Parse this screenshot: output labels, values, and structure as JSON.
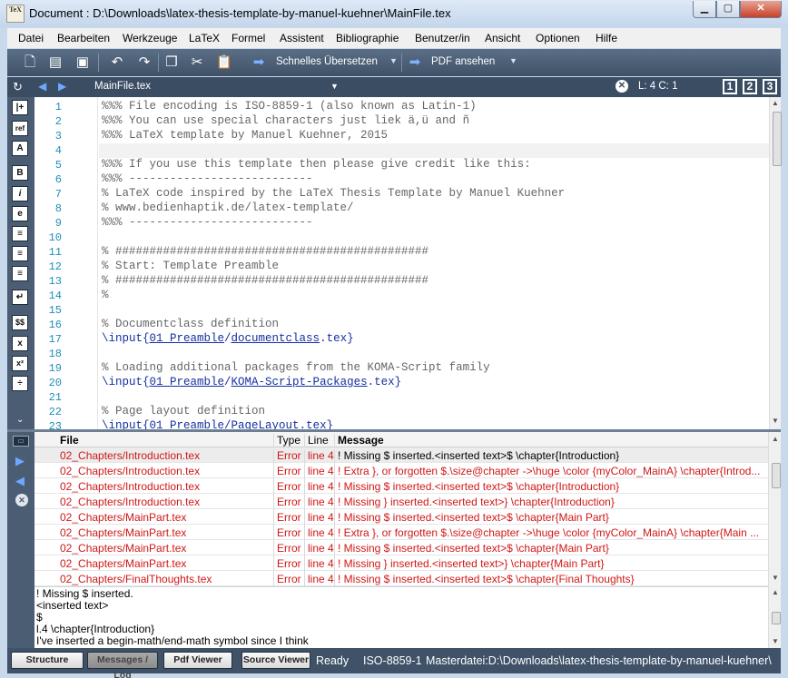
{
  "window": {
    "title": "Document : D:\\Downloads\\latex-thesis-template-by-manuel-kuehner\\MainFile.tex",
    "app_icon_text": "TeX",
    "minimize": "▁",
    "maximize": "▢",
    "close": "✕"
  },
  "menu": [
    "Datei",
    "Bearbeiten",
    "Werkzeuge",
    "LaTeX",
    "Formel",
    "Assistent",
    "Bibliographie",
    "Benutzer/in",
    "Ansicht",
    "Optionen",
    "Hilfe"
  ],
  "toolbar": {
    "build_label": "Schnelles Übersetzen",
    "view_label": "PDF ansehen",
    "icons": [
      "new-file-icon",
      "open-file-icon",
      "save-icon",
      "undo-icon",
      "redo-icon",
      "copy-icon",
      "cut-icon",
      "paste-icon",
      "run-arrow-icon",
      "view-arrow-icon"
    ]
  },
  "tabbar": {
    "file_name": "MainFile.tex",
    "cursor_pos": "L: 4 C: 1",
    "view1": "1",
    "view2": "2",
    "view3": "3"
  },
  "left_panel_icons": [
    "|+",
    "ref",
    "A",
    "B",
    "i",
    "e",
    "≡",
    "≡",
    "≡",
    "↵",
    "$$",
    "x",
    "x²",
    "÷"
  ],
  "editor": {
    "lines": [
      {
        "num": "1",
        "text": "%%% File encoding is ISO-8859-1 (also known as Latin-1)"
      },
      {
        "num": "2",
        "text": "%%% You can use special characters just liek ä,ü and ñ"
      },
      {
        "num": "3",
        "text": "%%% LaTeX template by Manuel Kuehner, 2015"
      },
      {
        "num": "4",
        "text": ""
      },
      {
        "num": "5",
        "text": "%%% If you use this template then please give credit like this:"
      },
      {
        "num": "6",
        "text": "%%% ---------------------------"
      },
      {
        "num": "7",
        "text": "% LaTeX code inspired by the LaTeX Thesis Template by Manuel Kuehner"
      },
      {
        "num": "8",
        "text": "% www.bedienhaptik.de/latex-template/"
      },
      {
        "num": "9",
        "text": "%%% ---------------------------"
      },
      {
        "num": "10",
        "text": ""
      },
      {
        "num": "11",
        "text": "% ##############################################"
      },
      {
        "num": "12",
        "text": "% Start: Template Preamble"
      },
      {
        "num": "13",
        "text": "% ##############################################"
      },
      {
        "num": "14",
        "text": "%"
      },
      {
        "num": "15",
        "text": ""
      },
      {
        "num": "16",
        "text": "% Documentclass definition"
      },
      {
        "num": "17",
        "text": "\\input{01_Preamble/documentclass.tex}"
      },
      {
        "num": "18",
        "text": ""
      },
      {
        "num": "19",
        "text": "% Loading additional packages from the KOMA-Script family"
      },
      {
        "num": "20",
        "text": "\\input{01_Preamble/KOMA-Script-Packages.tex}"
      },
      {
        "num": "21",
        "text": ""
      },
      {
        "num": "22",
        "text": "% Page layout definition"
      },
      {
        "num": "23",
        "text": "\\input{01_Preamble/PageLayout.tex}"
      }
    ]
  },
  "messages": {
    "headers": {
      "file": "File",
      "type": "Type",
      "line": "Line",
      "message": "Message"
    },
    "rows": [
      {
        "file": "02_Chapters/Introduction.tex",
        "type": "Error",
        "line": "line 4",
        "message": "! Missing $ inserted.<inserted text>$ \\chapter{Introduction}"
      },
      {
        "file": "02_Chapters/Introduction.tex",
        "type": "Error",
        "line": "line 4",
        "message": "! Extra }, or forgotten $.\\size@chapter ->\\huge \\color {myColor_MainA} \\chapter{Introd..."
      },
      {
        "file": "02_Chapters/Introduction.tex",
        "type": "Error",
        "line": "line 4",
        "message": "! Missing $ inserted.<inserted text>$ \\chapter{Introduction}"
      },
      {
        "file": "02_Chapters/Introduction.tex",
        "type": "Error",
        "line": "line 4",
        "message": "! Missing } inserted.<inserted text>} \\chapter{Introduction}"
      },
      {
        "file": "02_Chapters/MainPart.tex",
        "type": "Error",
        "line": "line 4",
        "message": "! Missing $ inserted.<inserted text>$ \\chapter{Main Part}"
      },
      {
        "file": "02_Chapters/MainPart.tex",
        "type": "Error",
        "line": "line 4",
        "message": "! Extra }, or forgotten $.\\size@chapter ->\\huge \\color {myColor_MainA} \\chapter{Main ..."
      },
      {
        "file": "02_Chapters/MainPart.tex",
        "type": "Error",
        "line": "line 4",
        "message": "! Missing $ inserted.<inserted text>$ \\chapter{Main Part}"
      },
      {
        "file": "02_Chapters/MainPart.tex",
        "type": "Error",
        "line": "line 4",
        "message": "! Missing } inserted.<inserted text>} \\chapter{Main Part}"
      },
      {
        "file": "02_Chapters/FinalThoughts.tex",
        "type": "Error",
        "line": "line 4",
        "message": "! Missing $ inserted.<inserted text>$ \\chapter{Final Thoughts}"
      }
    ]
  },
  "log": [
    "! Missing $ inserted.",
    "<inserted text>",
    "$",
    "l.4 \\chapter{Introduction}",
    "I've inserted a begin-math/end-math symbol since I think"
  ],
  "statusbar": {
    "buttons": [
      "Structure",
      "Messages / Log",
      "Pdf Viewer",
      "Source Viewer"
    ],
    "status": "Ready",
    "encoding": "ISO-8859-1",
    "master": "Masterdatei:D:\\Downloads\\latex-thesis-template-by-manuel-kuehner\\"
  },
  "colors": {
    "error_red": "#d01818",
    "line_number_blue": "#1d8fb8",
    "command_blue": "#142fa0",
    "panel": "#4b5d73"
  }
}
